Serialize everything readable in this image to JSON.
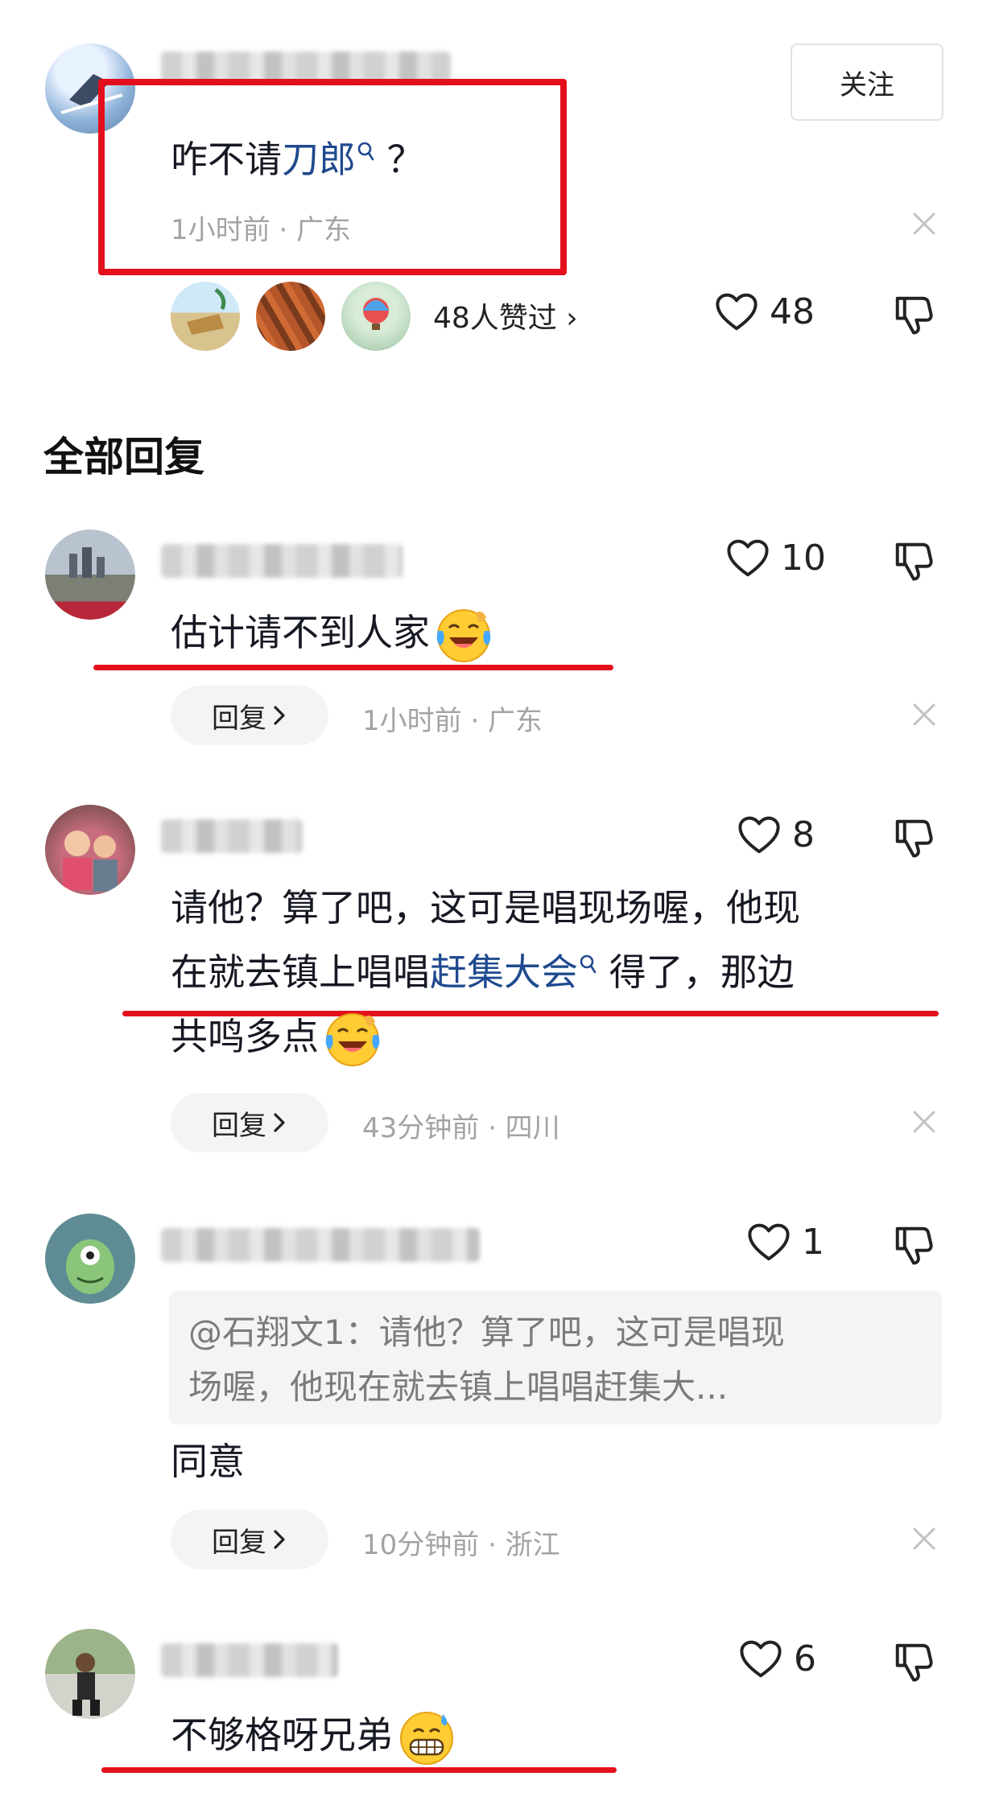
{
  "main_comment": {
    "text_prefix": "咋不请",
    "link": "刀郎",
    "text_suffix": " ？",
    "meta": "1小时前 · 广东",
    "liked_by": "48人赞过 ›",
    "likes": "48",
    "follow_label": "关注"
  },
  "section_title": "全部回复",
  "replies": [
    {
      "text": "估计请不到人家",
      "likes": "10",
      "reply_label": "回复",
      "meta": "1小时前 · 广东"
    },
    {
      "line1": "请他？算了吧，这可是唱现场喔，他现",
      "line2_prefix": "在就去镇上唱唱",
      "line2_link": "赶集大会",
      "line2_suffix": " 得了，那边",
      "line3": "共鸣多点",
      "likes": "8",
      "reply_label": "回复",
      "meta": "43分钟前 · 四川"
    },
    {
      "quote_line1": "@石翔文1：请他？算了吧，这可是唱现",
      "quote_line2": "场喔，他现在就去镇上唱唱赶集大...",
      "text": "同意",
      "likes": "1",
      "reply_label": "回复",
      "meta": "10分钟前 · 浙江"
    },
    {
      "text": "不够格呀兄弟",
      "likes": "6"
    }
  ],
  "colors": {
    "highlight_red": "#e3101b",
    "link_blue": "#1f4a8f",
    "meta_gray": "#a3a3a3"
  },
  "icons": [
    "heart-icon",
    "thumb-down-icon",
    "close-icon",
    "search-icon",
    "chevron-right-icon",
    "laughing-crying-emoji",
    "grinning-sweat-emoji"
  ]
}
